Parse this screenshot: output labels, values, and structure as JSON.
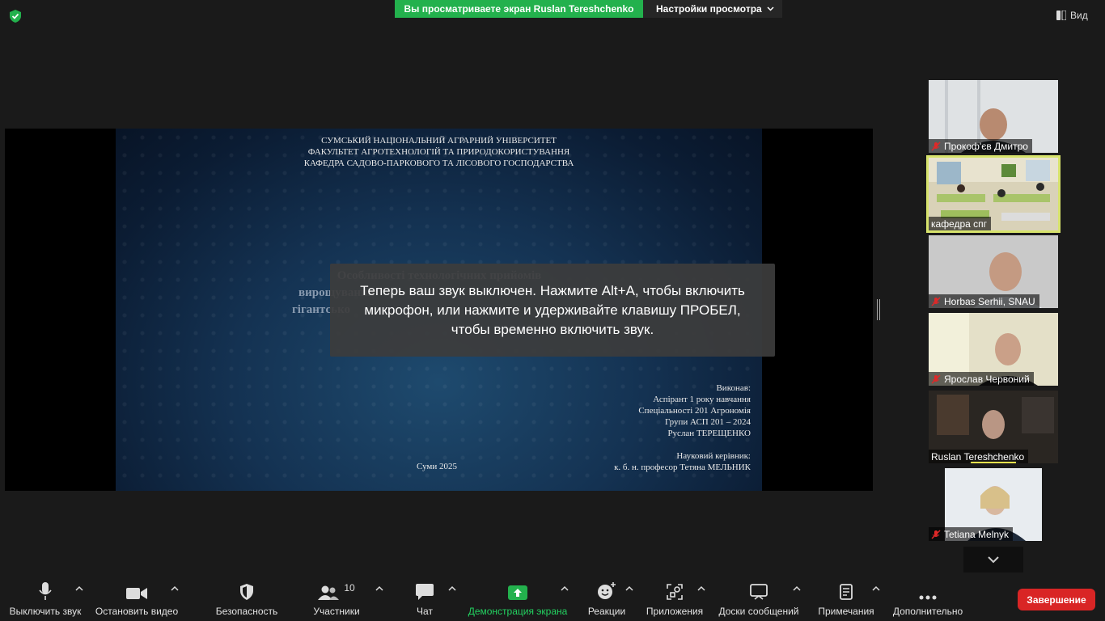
{
  "top": {
    "share_text": "Вы просматриваете экран Ruslan Tereshchenko",
    "view_settings": "Настройки просмотра",
    "view_label": "Вид"
  },
  "slide": {
    "header": [
      "СУМСЬКИЙ НАЦІОНАЛЬНИЙ АГРАРНИЙ УНІВЕРСИТЕТ",
      "ФАКУЛЬТЕТ АГРОТЕХНОЛОГІЙ ТА ПРИРОДОКОРИСТУВАННЯ",
      "КАФЕДРА САДОВО-ПАРКОВОГО ТА ЛІСОВОГО ГОСПОДАРСТВА"
    ],
    "title_line1": "Особливості технологічних прийомів",
    "title_line2": "вирощування",
    "title_line3": "гігантсько",
    "author": [
      "Виконав:",
      "Аспірант 1 року навчання",
      "Спеціальності 201 Агрономія",
      "Групи АСП 201 – 2024",
      "Руслан ТЕРЕЩЕНКО",
      "",
      "Науковий керівник:",
      "к. б. н. професор Тетяна МЕЛЬНИК"
    ],
    "city": "Суми 2025"
  },
  "notice": "Теперь ваш звук выключен. Нажмите Alt+A, чтобы включить микрофон, или нажмите и удерживайте клавишу ПРОБЕЛ, чтобы временно включить звук.",
  "participants": [
    {
      "name": "Прокоф'єв Дмитро",
      "muted": true
    },
    {
      "name": "кафедра спг",
      "muted": false,
      "active": true
    },
    {
      "name": "Horbas Serhii, SNAU",
      "muted": true
    },
    {
      "name": "Ярослав Червоний",
      "muted": true
    },
    {
      "name": "Ruslan Tereshchenko",
      "muted": false
    },
    {
      "name": "Tetiana Melnyk",
      "muted": true
    }
  ],
  "toolbar": {
    "mute": "Выключить звук",
    "video": "Остановить видео",
    "security": "Безопасность",
    "participants": "Участники",
    "participants_count": "10",
    "chat": "Чат",
    "share": "Демонстрация экрана",
    "reactions": "Реакции",
    "apps": "Приложения",
    "whiteboards": "Доски сообщений",
    "notes": "Примечания",
    "more": "Дополнительно",
    "end": "Завершение"
  },
  "colors": {
    "share_green": "#23b14d",
    "end_red": "#d92525",
    "active_border": "#d7e36c",
    "muted_red": "#e02828"
  }
}
